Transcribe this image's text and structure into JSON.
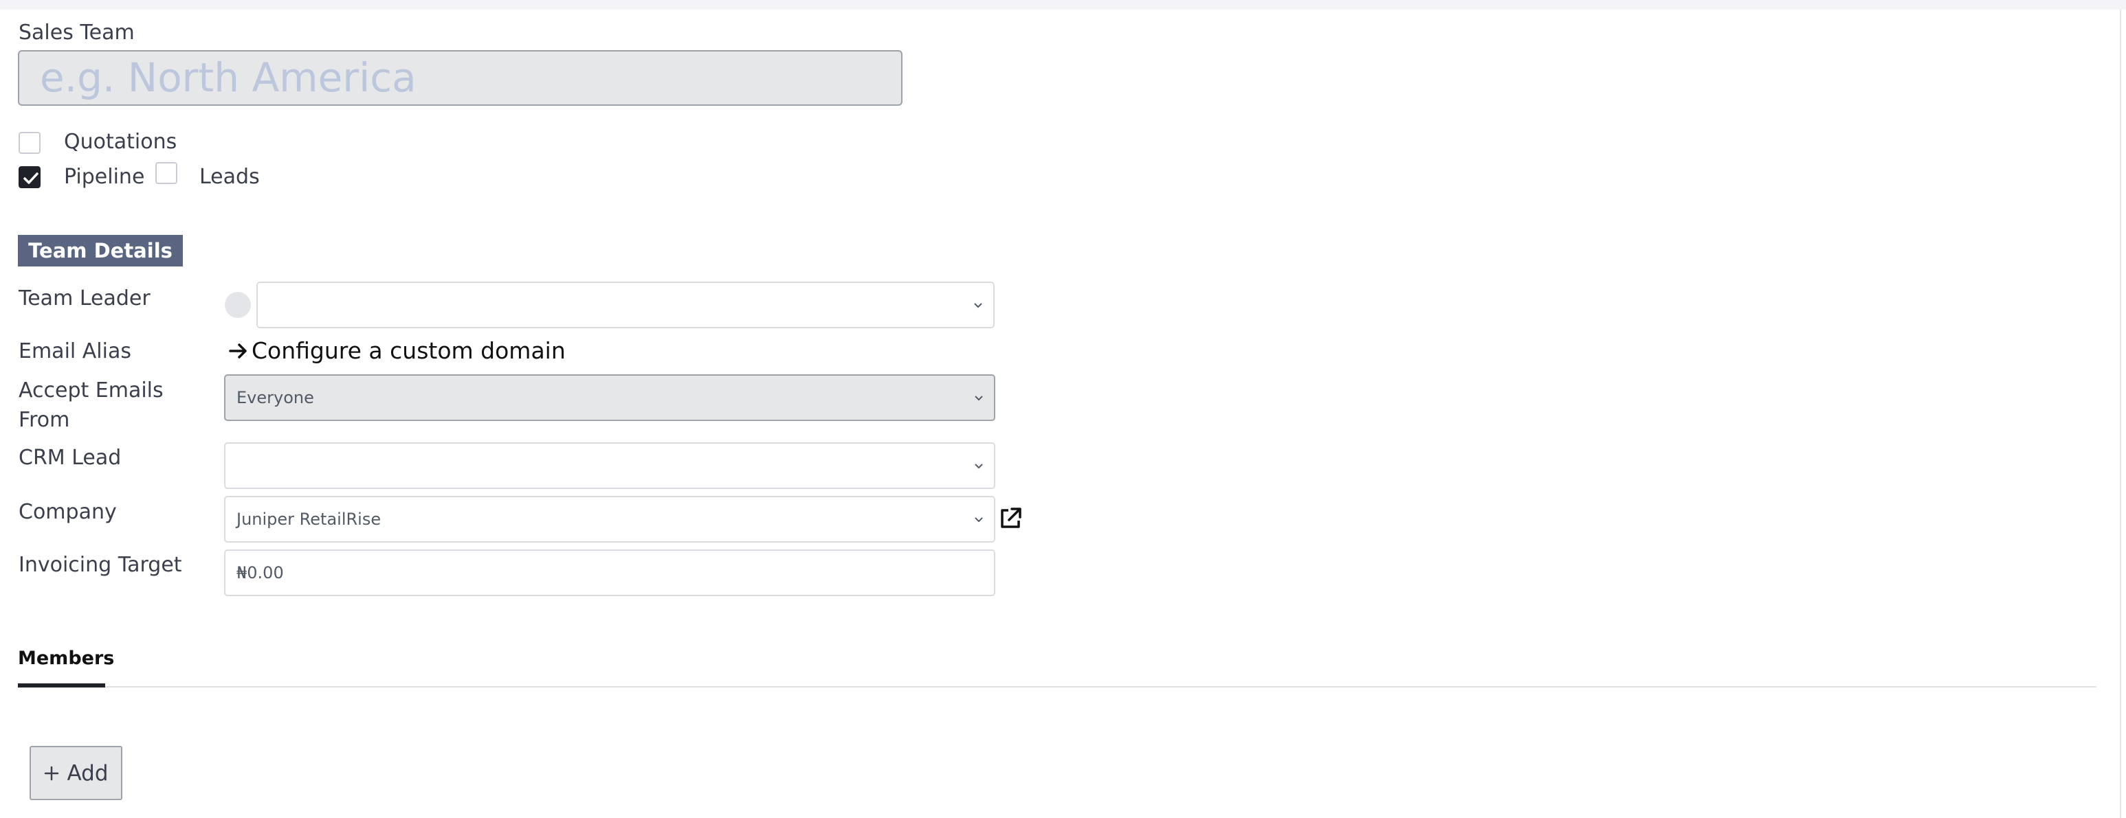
{
  "form": {
    "sales_team_label": "Sales Team",
    "sales_team_placeholder": "e.g. North America",
    "checkboxes": {
      "quotations": {
        "label": "Quotations",
        "checked": false
      },
      "pipeline": {
        "label": "Pipeline",
        "checked": true
      },
      "leads": {
        "label": "Leads",
        "checked": false
      }
    }
  },
  "team_details": {
    "header": "Team Details",
    "team_leader_label": "Team Leader",
    "team_leader_value": "",
    "email_alias_label": "Email Alias",
    "email_alias_link": "Configure a custom domain",
    "accept_emails_label_line1": "Accept Emails",
    "accept_emails_label_line2": "From",
    "accept_emails_value": "Everyone",
    "crm_lead_label": "CRM Lead",
    "crm_lead_value": "",
    "company_label": "Company",
    "company_value": "Juniper RetailRise",
    "invoicing_target_label": "Invoicing Target",
    "invoicing_target_value": "₦0.00"
  },
  "tabs": {
    "members": "Members"
  },
  "members": {
    "add_label": "Add"
  },
  "colors": {
    "accent_header": "#5a6582",
    "checkbox_checked": "#1f2329",
    "placeholder": "#bcc6dc"
  },
  "icons": {
    "external_link": "external-link-icon",
    "arrow": "arrow-right-icon",
    "dropdown": "chevron-down-icon",
    "plus": "plus-icon"
  }
}
